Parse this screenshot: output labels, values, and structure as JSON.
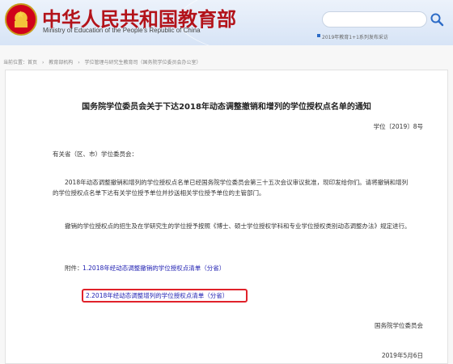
{
  "header": {
    "site_title": "中华人民共和国教育部",
    "site_subtitle": "Ministry of Education of the People's Republic of China",
    "search_placeholder": "",
    "ticker_text": "2019年教育1+1系列发布采访"
  },
  "breadcrumb": [
    "当前位置：首页",
    "教育部机构",
    "学位管理与研究生教育司（国务院学位委员会办公室）"
  ],
  "document": {
    "title": "国务院学位委员会关于下达2018年动态调整撤销和增列的学位授权点名单的通知",
    "number": "学位〔2019〕8号",
    "salutation": "有关省（区、市）学位委员会：",
    "paragraph1": "2018年动态调整撤销和增列的学位授权点名单已经国务院学位委员会第三十五次会议审议批准，现印发给你们。请将撤销和增列的学位授权点名单下达有关学位授予单位并抄送相关学位授予单位的主管部门。",
    "paragraph2": "撤销的学位授权点的招生及在学研究生的学位授予按照《博士、硕士学位授权学科和专业学位授权类别动态调整办法》规定进行。",
    "attachments_label": "附件：",
    "attachment1": "1.2018年经动态调整撤销的学位授权点清单（分省）",
    "attachment2": "2.2018年经动态调整增列的学位授权点清单（分省）",
    "signature": "国务院学位委员会",
    "date": "2019年5月6日"
  },
  "colors": {
    "title_red": "#b3131a",
    "link_blue": "#1b1bb0",
    "highlight_red": "#e0222a"
  }
}
